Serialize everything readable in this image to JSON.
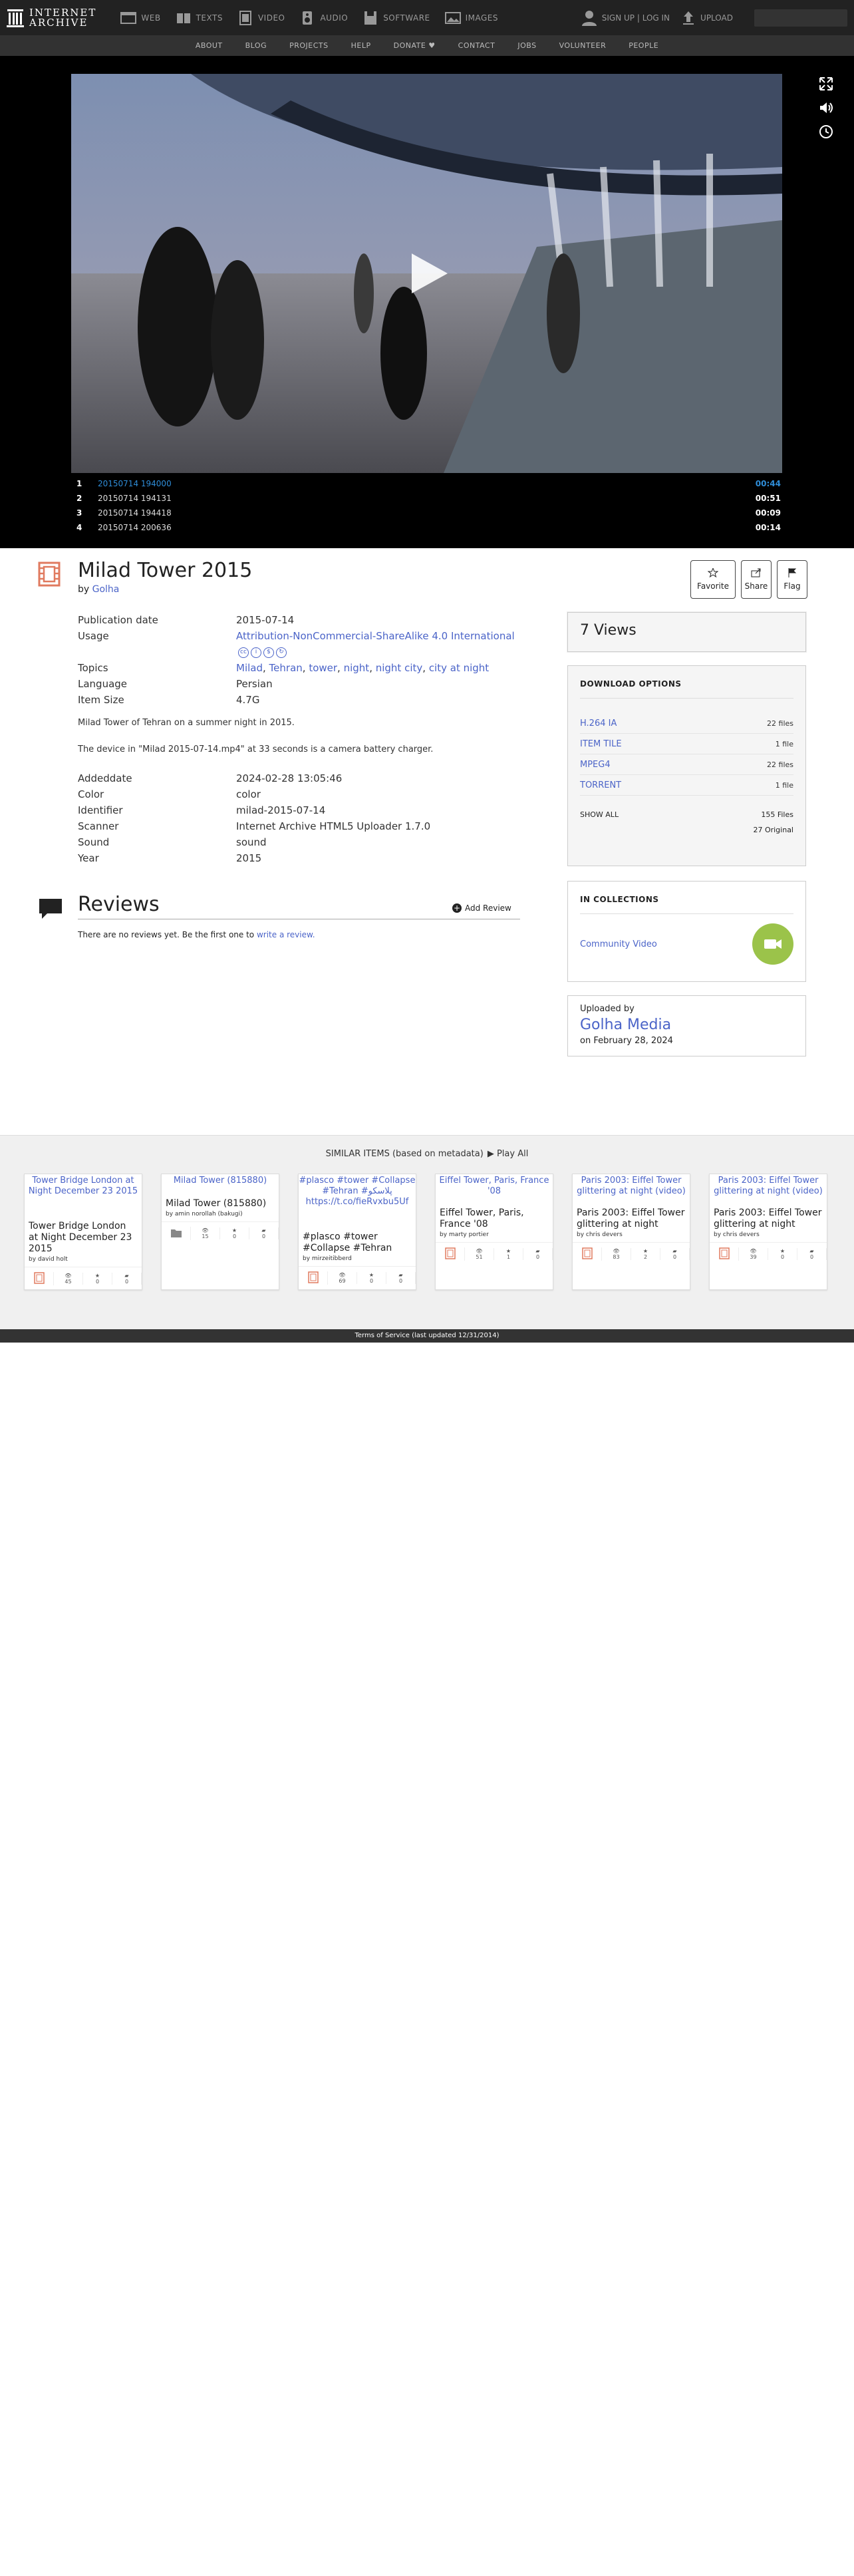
{
  "nav": {
    "logo_line1": "INTERNET",
    "logo_line2": "ARCHIVE",
    "media": [
      "WEB",
      "TEXTS",
      "VIDEO",
      "AUDIO",
      "SOFTWARE",
      "IMAGES"
    ],
    "signup": "SIGN UP | LOG IN",
    "upload": "UPLOAD"
  },
  "subnav": [
    "ABOUT",
    "BLOG",
    "PROJECTS",
    "HELP",
    "DONATE",
    "CONTACT",
    "JOBS",
    "VOLUNTEER",
    "PEOPLE"
  ],
  "playlist": [
    {
      "num": "1",
      "title": "20150714 194000",
      "dur": "00:44",
      "active": true
    },
    {
      "num": "2",
      "title": "20150714 194131",
      "dur": "00:51",
      "active": false
    },
    {
      "num": "3",
      "title": "20150714 194418",
      "dur": "00:09",
      "active": false
    },
    {
      "num": "4",
      "title": "20150714 200636",
      "dur": "00:14",
      "active": false
    }
  ],
  "item": {
    "title": "Milad Tower 2015",
    "by_prefix": "by",
    "creator": "Golha",
    "actions": {
      "favorite": "Favorite",
      "share": "Share",
      "flag": "Flag"
    },
    "metadata": {
      "pubdate_key": "Publication date",
      "pubdate": "2015-07-14",
      "usage_key": "Usage",
      "usage": "Attribution-NonCommercial-ShareAlike 4.0 International",
      "topics_key": "Topics",
      "topics": [
        "Milad",
        "Tehran",
        "tower",
        "night",
        "night city",
        "city at night"
      ],
      "language_key": "Language",
      "language": "Persian",
      "size_key": "Item Size",
      "size": "4.7G"
    },
    "description": [
      "Milad Tower of Tehran on a summer night in 2015.",
      "The device in \"Milad 2015-07-14.mp4\" at 33 seconds is a camera battery charger."
    ],
    "extra": [
      {
        "key": "Addeddate",
        "val": "2024-02-28 13:05:46"
      },
      {
        "key": "Color",
        "val": "color"
      },
      {
        "key": "Identifier",
        "val": "milad-2015-07-14"
      },
      {
        "key": "Scanner",
        "val": "Internet Archive HTML5 Uploader 1.7.0"
      },
      {
        "key": "Sound",
        "val": "sound"
      },
      {
        "key": "Year",
        "val": "2015"
      }
    ]
  },
  "reviews": {
    "title": "Reviews",
    "add": "Add Review",
    "none_text": "There are no reviews yet. Be the first one to",
    "write_link": "write a review."
  },
  "sidebar": {
    "views": "7 Views",
    "downloads_head": "DOWNLOAD OPTIONS",
    "downloads": [
      {
        "label": "H.264 IA",
        "count": "22 files"
      },
      {
        "label": "ITEM TILE",
        "count": "1 file"
      },
      {
        "label": "MPEG4",
        "count": "22 files"
      },
      {
        "label": "TORRENT",
        "count": "1 file"
      }
    ],
    "show_all": "SHOW ALL",
    "total_files": "155 Files",
    "original": "27 Original",
    "collections_head": "IN COLLECTIONS",
    "collection": "Community Video",
    "uploaded_by": "Uploaded by",
    "uploader": "Golha Media",
    "upload_date": "on February 28, 2024"
  },
  "similar": {
    "head": "SIMILAR ITEMS (based on metadata)",
    "play_all": "Play All",
    "items": [
      {
        "thumb_alt": "Tower Bridge London at Night December 23 2015",
        "title": "Tower Bridge London at Night December 23 2015",
        "by": "by david holt",
        "views": "45",
        "favs": "0",
        "reviews": "0"
      },
      {
        "thumb_alt": "Milad Tower (815880)",
        "title": "Milad Tower (815880)",
        "by": "by amin norollah (bakugi)",
        "views": "15",
        "favs": "0",
        "reviews": "0"
      },
      {
        "thumb_alt": "#plasco #tower #Collapse #Tehran #پلاسکو https://t.co/fieRvxbu5Uf",
        "title": "#plasco #tower #Collapse #Tehran",
        "by": "by mirzeitibberd",
        "views": "69",
        "favs": "0",
        "reviews": "0"
      },
      {
        "thumb_alt": "Eiffel Tower, Paris, France '08",
        "title": "Eiffel Tower, Paris, France '08",
        "by": "by marty portier",
        "views": "51",
        "favs": "1",
        "reviews": "0"
      },
      {
        "thumb_alt": "Paris 2003: Eiffel Tower glittering at night (video)",
        "title": "Paris 2003: Eiffel Tower glittering at night",
        "by": "by chris devers",
        "views": "83",
        "favs": "2",
        "reviews": "0"
      },
      {
        "thumb_alt": "Paris 2003: Eiffel Tower glittering at night (video)",
        "title": "Paris 2003: Eiffel Tower glittering at night",
        "by": "by chris devers",
        "views": "39",
        "favs": "0",
        "reviews": "0"
      }
    ]
  },
  "footer": "Terms of Service (last updated 12/31/2014)"
}
